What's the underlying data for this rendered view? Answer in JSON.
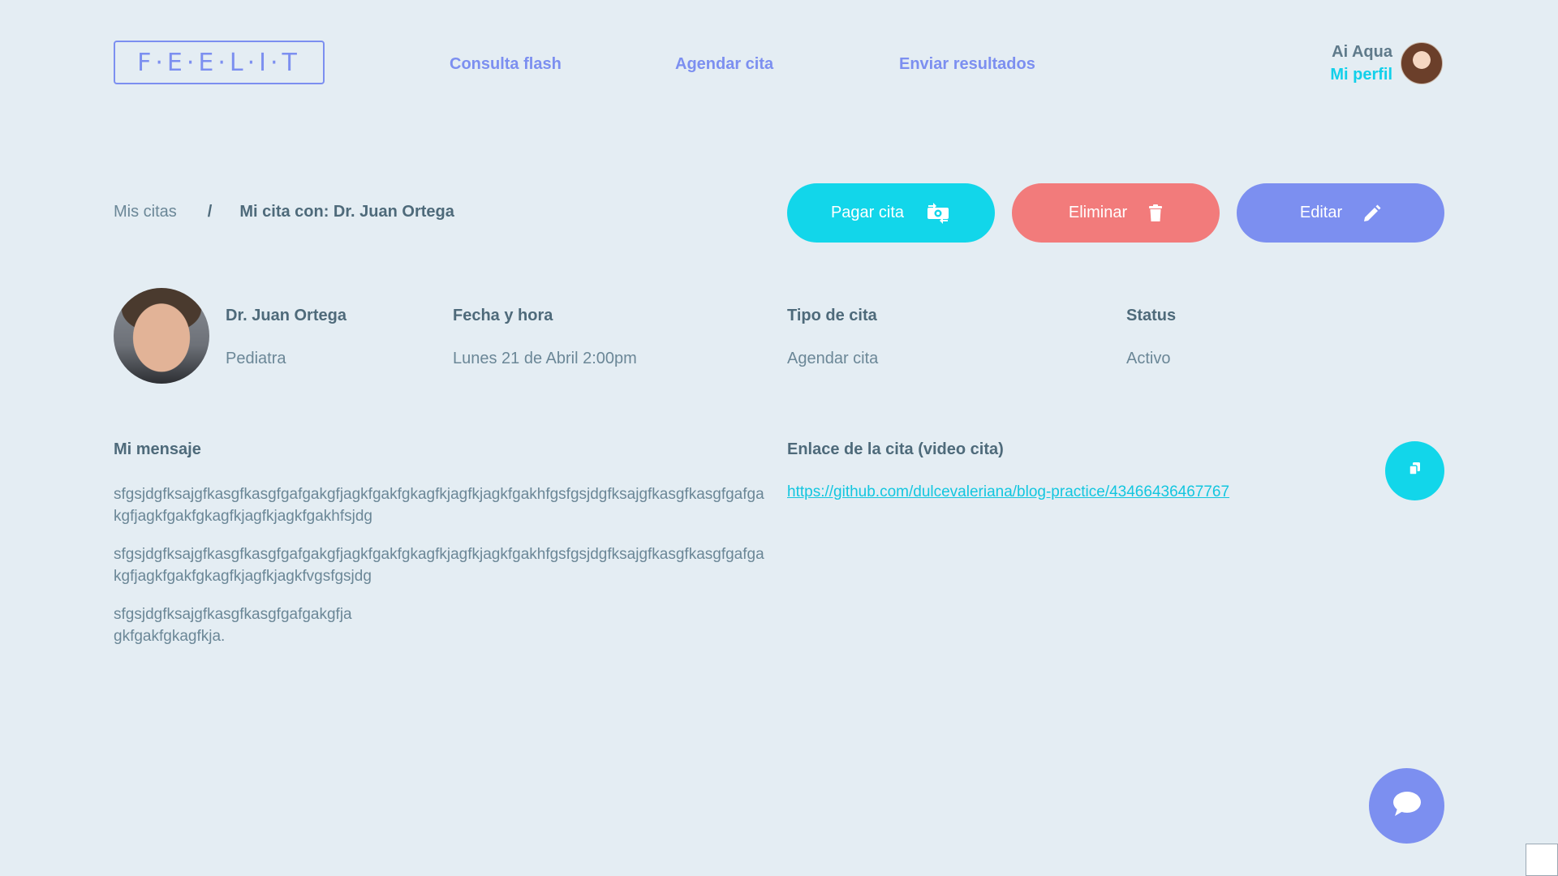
{
  "header": {
    "logo_text": "F·E·E·L·I·T",
    "nav": [
      {
        "label": "Consulta flash"
      },
      {
        "label": "Agendar cita"
      },
      {
        "label": "Enviar resultados"
      }
    ],
    "user": {
      "name": "Ai Aqua",
      "profile_link": "Mi perfil"
    }
  },
  "breadcrumb": {
    "parent": "Mis citas",
    "separator": "/",
    "current": "Mi cita con: Dr. Juan Ortega"
  },
  "actions": {
    "pay_label": "Pagar cita",
    "delete_label": "Eliminar",
    "edit_label": "Editar"
  },
  "appointment": {
    "doctor_name": "Dr. Juan Ortega",
    "specialty": "Pediatra",
    "date_head": "Fecha y hora",
    "date_value": "Lunes 21 de Abril 2:00pm",
    "type_head": "Tipo de cita",
    "type_value": "Agendar cita",
    "status_head": "Status",
    "status_value": "Activo"
  },
  "message": {
    "title": "Mi mensaje",
    "paragraphs": [
      "sfgsjdgfksajgfkasgfkasgfgafgakgfjagkfgakfgkagfkjagfkjagkfgakhfgsfgsjdgfksajgfkasgfkasgfgafgakgfjagkfgakfgkagfkjagfkjagkfgakhfsjdg",
      "sfgsjdgfksajgfkasgfkasgfgafgakgfjagkfgakfgkagfkjagfkjagkfgakhfgsfgsjdgfksajgfkasgfkasgfgafgakgfjagkfgakfgkagfkjagfkjagkfvgsfgsjdg",
      "sfgsjdgfksajgfkasgfkasgfgafgakgfja gkfgakfgkagfkja."
    ]
  },
  "link": {
    "title": "Enlace de la cita (video cita)",
    "url": "https://github.com/dulcevaleriana/blog-practice/43466436467767"
  },
  "icons": {
    "pay": "money-exchange-icon",
    "delete": "trash-icon",
    "edit": "pencil-icon",
    "copy": "copy-icon",
    "chat": "chat-bubble-icon"
  },
  "colors": {
    "primary": "#7c8ff0",
    "accent": "#12d6ea",
    "danger": "#f27b7b",
    "background": "#e4edf3",
    "text": "#5f7a8a"
  }
}
